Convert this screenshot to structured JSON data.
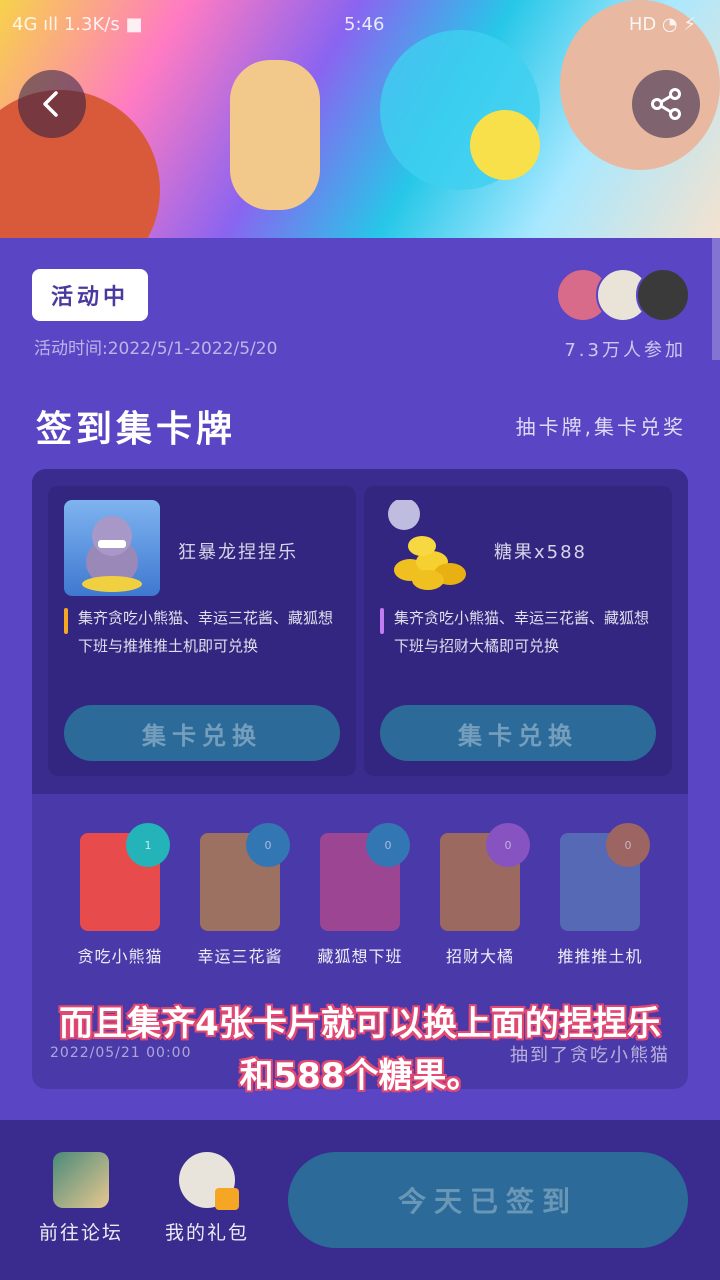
{
  "status_bar": {
    "left": "4G ıll  1.3K/s ■",
    "time": "5:46",
    "right": "HD ◔ ⚡"
  },
  "activity": {
    "status_badge": "活动中",
    "time": "活动时间:2022/5/1-2022/5/20",
    "participants": "7.3万人参加"
  },
  "section": {
    "title": "签到集卡牌",
    "subtitle": "抽卡牌,集卡兑奖"
  },
  "rewards": [
    {
      "name": "狂暴龙捏捏乐",
      "desc": "集齐贪吃小熊猫、幸运三花酱、藏狐想下班与推推推土机即可兑换",
      "button": "集卡兑换",
      "accent": "#f5a623"
    },
    {
      "name": "糖果x588",
      "desc": "集齐贪吃小熊猫、幸运三花酱、藏狐想下班与招财大橘即可兑换",
      "button": "集卡兑换",
      "accent": "#c07cf0"
    }
  ],
  "cards": [
    {
      "name": "贪吃小熊猫",
      "count": "1",
      "color": "#e84b4b",
      "badge": "#23b3b8"
    },
    {
      "name": "幸运三花酱",
      "count": "0",
      "color": "#b8844a",
      "badge": "#2b8cb8"
    },
    {
      "name": "藏狐想下班",
      "count": "0",
      "color": "#b84a8c",
      "badge": "#2b8cb8"
    },
    {
      "name": "招财大橘",
      "count": "0",
      "color": "#b87a4a",
      "badge": "#9a5cc8"
    },
    {
      "name": "推推推土机",
      "count": "0",
      "color": "#5a7ab8",
      "badge": "#b8744a"
    }
  ],
  "log": {
    "date": "2022/05/21 00:00",
    "message": "抽到了贪吃小熊猫"
  },
  "caption": {
    "line1": "而且集齐4张卡片就可以换上面的捏捏乐",
    "line2": "和588个糖果。"
  },
  "bottom": {
    "forum": "前往论坛",
    "gifts": "我的礼包",
    "checkin": "今天已签到"
  }
}
